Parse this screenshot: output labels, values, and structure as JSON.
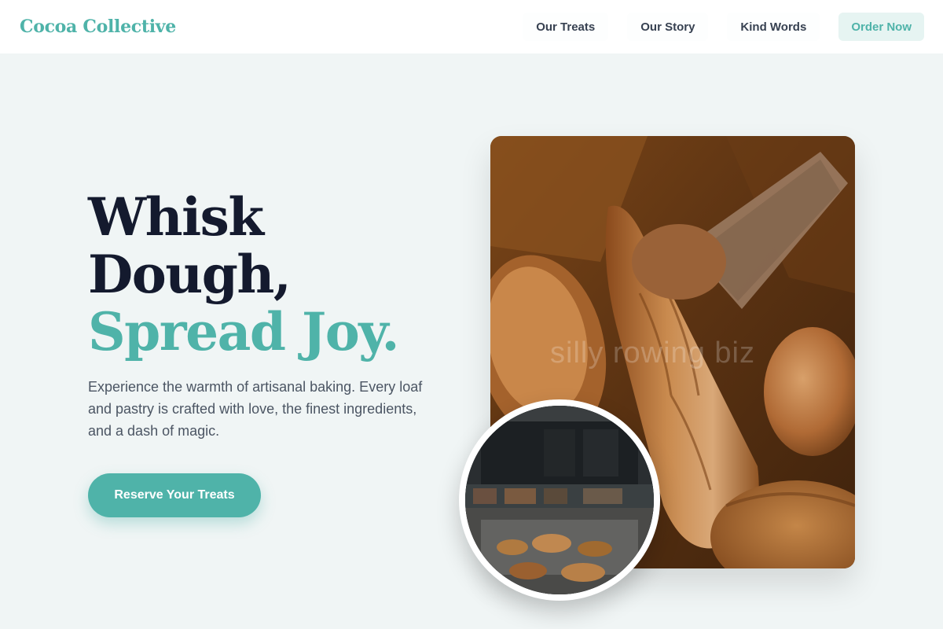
{
  "brand": {
    "name": "Cocoa Collective"
  },
  "nav": {
    "links": [
      "Our Treats",
      "Our Story",
      "Kind Words"
    ],
    "cta": "Order Now"
  },
  "hero": {
    "title_line1": "Whisk",
    "title_line2": "Dough,",
    "title_line3": "Spread Joy.",
    "description": "Experience the warmth of artisanal baking. Every loaf and pastry is crafted with love, the finest ingredients, and a dash of magic.",
    "button": "Reserve Your Treats"
  },
  "images": {
    "main": "bread-loaves-photo",
    "inset": "bakery-shop-interior-photo",
    "watermark": "silly rowing biz"
  },
  "colors": {
    "accent": "#4fb3a9",
    "heading": "#141a2e",
    "body_text": "#4b5563",
    "background": "#f0f5f5"
  }
}
